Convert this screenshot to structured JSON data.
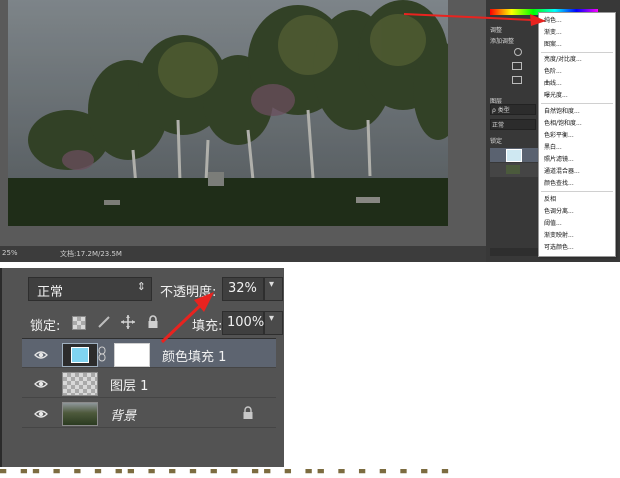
{
  "app": {
    "zoom": "25%",
    "doc_info": "文档:17.2M/23.5M",
    "panel_tabs": {
      "adjustments": "调整",
      "add_adjustment": "添加调整",
      "layers": "图层",
      "kind": "ρ 类型",
      "blend": "正常",
      "lock": "锁定"
    }
  },
  "fill_menu": {
    "items": [
      "纯色...",
      "渐变...",
      "图案...",
      "亮度/对比度...",
      "色阶...",
      "曲线...",
      "曝光度...",
      "自然饱和度...",
      "色相/饱和度...",
      "色彩平衡...",
      "黑白...",
      "照片滤镜...",
      "通道混合器...",
      "颜色查找...",
      "反相",
      "色调分离...",
      "阈值...",
      "渐变映射...",
      "可选颜色..."
    ]
  },
  "layers_panel": {
    "blend_mode": "正常",
    "opacity_label": "不透明度:",
    "opacity_value": "32%",
    "lock_label": "锁定:",
    "fill_label": "填充:",
    "fill_value": "100%",
    "layers": [
      {
        "name": "颜色填充 1",
        "selected": true
      },
      {
        "name": "图层 1",
        "selected": false
      },
      {
        "name": "背景",
        "selected": false,
        "locked": true
      }
    ],
    "fill_swatch_color": "#7fd3f0"
  },
  "colors": {
    "selected_row": "#5d6470",
    "arrow_red": "#e8231f"
  }
}
